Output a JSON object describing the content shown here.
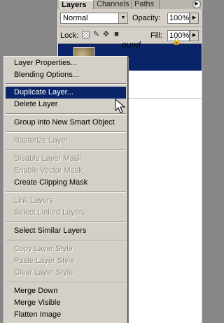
{
  "panel": {
    "tabs": [
      {
        "label": "Layers",
        "active": true
      },
      {
        "label": "Channels",
        "active": false
      },
      {
        "label": "Paths",
        "active": false
      }
    ],
    "menu_button_icon": "panel-menu-icon",
    "blend_mode": "Normal",
    "opacity_label": "Opacity:",
    "opacity_value": "100%",
    "lock_label": "Lock:",
    "fill_label": "Fill:",
    "fill_value": "100%",
    "lock_icons": [
      "transparency-lock-icon",
      "brush-lock-icon",
      "move-lock-icon",
      "padlock-icon"
    ],
    "layers": [
      {
        "name": "",
        "selected": true
      },
      {
        "name": "ound",
        "selected": false,
        "locked": true
      }
    ]
  },
  "context_menu": {
    "items": [
      {
        "label": "Layer Properties...",
        "disabled": false
      },
      {
        "label": "Blending Options...",
        "disabled": false
      },
      {
        "separator": true
      },
      {
        "label": "Duplicate Layer...",
        "disabled": false,
        "highlighted": true
      },
      {
        "label": "Delete Layer",
        "disabled": false
      },
      {
        "separator": true
      },
      {
        "label": "Group into New Smart Object",
        "disabled": false
      },
      {
        "separator": true
      },
      {
        "label": "Rasterize Layer",
        "disabled": true
      },
      {
        "separator": true
      },
      {
        "label": "Disable Layer Mask",
        "disabled": true
      },
      {
        "label": "Enable Vector Mask",
        "disabled": true
      },
      {
        "label": "Create Clipping Mask",
        "disabled": false
      },
      {
        "separator": true
      },
      {
        "label": "Link Layers",
        "disabled": true
      },
      {
        "label": "Select Linked Layers",
        "disabled": true
      },
      {
        "separator": true
      },
      {
        "label": "Select Similar Layers",
        "disabled": false
      },
      {
        "separator": true
      },
      {
        "label": "Copy Layer Style",
        "disabled": true
      },
      {
        "label": "Paste Layer Style",
        "disabled": true
      },
      {
        "label": "Clear Layer Style",
        "disabled": true
      },
      {
        "separator": true
      },
      {
        "label": "Merge Down",
        "disabled": false
      },
      {
        "label": "Merge Visible",
        "disabled": false
      },
      {
        "label": "Flatten Image",
        "disabled": false
      }
    ]
  }
}
